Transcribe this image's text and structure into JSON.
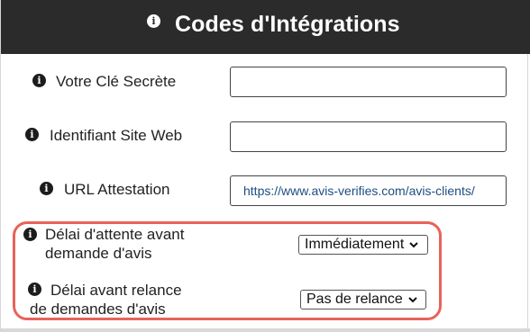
{
  "header": {
    "title": "Codes d'Intégrations",
    "icon": "info-icon"
  },
  "fields": {
    "secret_key": {
      "label": "Votre Clé Secrète",
      "value": ""
    },
    "site_id": {
      "label": "Identifiant Site Web",
      "value": ""
    },
    "url_attestation": {
      "label": "URL Attestation",
      "value": "https://www.avis-verifies.com/avis-clients/"
    }
  },
  "selects": {
    "delay": {
      "label_line1": "Délai d'attente avant",
      "label_line2": "demande d'avis",
      "value": "Immédiatement"
    },
    "reminder": {
      "label_line1": "Délai avant relance",
      "label_line2": "de demandes d'avis",
      "value": "Pas de relance"
    }
  },
  "colors": {
    "header_bg": "#2b2b2b",
    "highlight": "#e8625a",
    "link_text": "#1c4e80"
  }
}
